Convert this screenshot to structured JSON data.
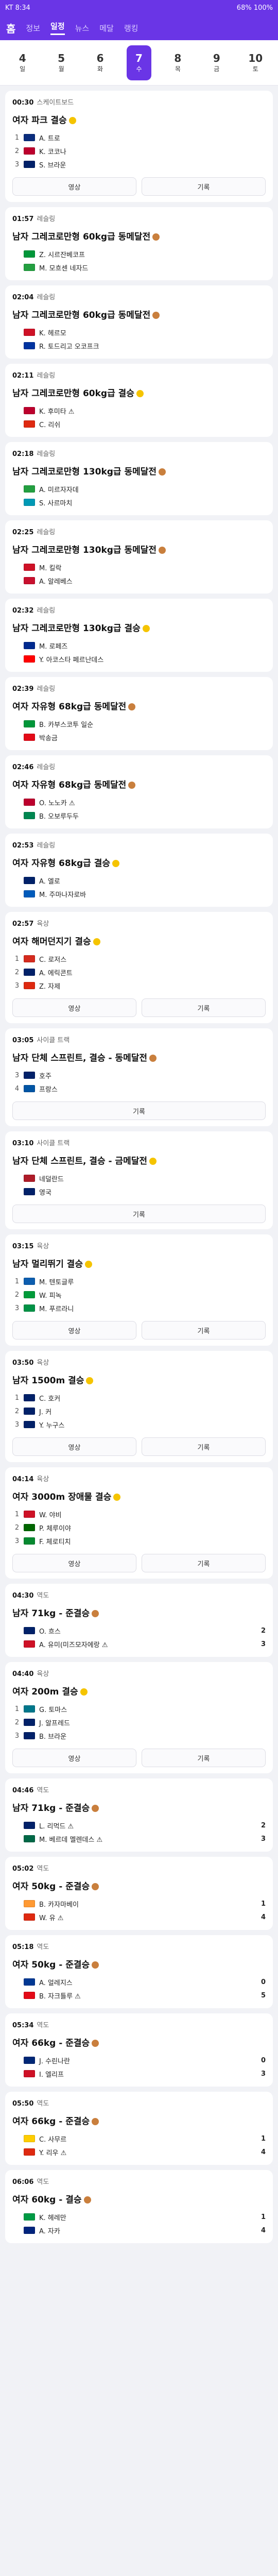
{
  "status": {
    "left": "KT 8:34",
    "right": "68% 100%"
  },
  "nav": {
    "logo": "홈",
    "tabs": [
      "정보",
      "일정",
      "뉴스",
      "메달",
      "랭킹"
    ],
    "active": 1
  },
  "dates": [
    {
      "day": "4",
      "dow": "일"
    },
    {
      "day": "5",
      "dow": "월"
    },
    {
      "day": "6",
      "dow": "화"
    },
    {
      "day": "7",
      "dow": "수"
    },
    {
      "day": "8",
      "dow": "목"
    },
    {
      "day": "9",
      "dow": "금"
    },
    {
      "day": "10",
      "dow": "토"
    }
  ],
  "active_date": 3,
  "events": [
    {
      "time": "00:30",
      "cat": "스케이트보드",
      "title": "여자 파크 결승",
      "medal": "gold",
      "rows": [
        {
          "rank": "1",
          "flag": "#0a2d7d",
          "name": "A. 트로"
        },
        {
          "rank": "2",
          "flag": "#bc002d",
          "name": "K. 코코나"
        },
        {
          "rank": "3",
          "flag": "#012169",
          "name": "S. 브라운"
        }
      ],
      "buttons": [
        "영상",
        "기록"
      ]
    },
    {
      "time": "01:57",
      "cat": "레슬링",
      "title": "남자 그레코로만형 60kg급 동메달전",
      "medal": "bronze",
      "rows": [
        {
          "rank": "",
          "flag": "#009639",
          "name": "Z. 시르잔베코프"
        },
        {
          "rank": "",
          "flag": "#239f40",
          "name": "M. 모흐센 네자드"
        }
      ]
    },
    {
      "time": "02:04",
      "cat": "레슬링",
      "title": "남자 그레코로만형 60kg급 동메달전",
      "medal": "bronze",
      "rows": [
        {
          "rank": "",
          "flag": "#ce1126",
          "name": "K. 헤르모"
        },
        {
          "rank": "",
          "flag": "#0033a0",
          "name": "R. 토드리고 오코프크"
        }
      ]
    },
    {
      "time": "02:11",
      "cat": "레슬링",
      "title": "남자 그레코로만형 60kg급 결승",
      "medal": "gold",
      "rows": [
        {
          "rank": "",
          "flag": "#bc002d",
          "name": "K. 후미타 ⚠"
        },
        {
          "rank": "",
          "flag": "#de2910",
          "name": "C. 리쉬"
        }
      ]
    },
    {
      "time": "02:18",
      "cat": "레슬링",
      "title": "남자 그레코로만형 130kg급 동메달전",
      "medal": "bronze",
      "rows": [
        {
          "rank": "",
          "flag": "#239f40",
          "name": "A. 미르자자데"
        },
        {
          "rank": "",
          "flag": "#0099b5",
          "name": "S. 사르마치"
        }
      ]
    },
    {
      "time": "02:25",
      "cat": "레슬링",
      "title": "남자 그레코로만형 130kg급 동메달전",
      "medal": "bronze",
      "rows": [
        {
          "rank": "",
          "flag": "#ce1126",
          "name": "M. 킬락"
        },
        {
          "rank": "",
          "flag": "#c8102e",
          "name": "A. 알레베스"
        }
      ]
    },
    {
      "time": "02:32",
      "cat": "레슬링",
      "title": "남자 그레코로만형 130kg급 결승",
      "medal": "gold",
      "rows": [
        {
          "rank": "",
          "flag": "#002a8f",
          "name": "M. 로페즈"
        },
        {
          "rank": "",
          "flag": "#ff0000",
          "name": "Y. 아코스타 페르난데스"
        }
      ]
    },
    {
      "time": "02:39",
      "cat": "레슬링",
      "title": "여자 자유형 68kg급 동메달전",
      "medal": "bronze",
      "rows": [
        {
          "rank": "",
          "flag": "#009639",
          "name": "B. 카부스코투 일순"
        },
        {
          "rank": "",
          "flag": "#e30a17",
          "name": "박송금"
        }
      ]
    },
    {
      "time": "02:46",
      "cat": "레슬링",
      "title": "여자 자유형 68kg급 동메달전",
      "medal": "bronze",
      "rows": [
        {
          "rank": "",
          "flag": "#bc002d",
          "name": "O. 노노카 ⚠"
        },
        {
          "rank": "",
          "flag": "#008751",
          "name": "B. 오보루두두"
        }
      ]
    },
    {
      "time": "02:53",
      "cat": "레슬링",
      "title": "여자 자유형 68kg급 결승",
      "medal": "gold",
      "rows": [
        {
          "rank": "",
          "flag": "#012169",
          "name": "A. 엘로"
        },
        {
          "rank": "",
          "flag": "#005bbb",
          "name": "M. 주마나자로바"
        }
      ]
    },
    {
      "time": "02:57",
      "cat": "육상",
      "title": "여자 해머던지기 결승",
      "medal": "gold",
      "rows": [
        {
          "rank": "1",
          "flag": "#d52b1e",
          "name": "C. 로저스"
        },
        {
          "rank": "2",
          "flag": "#012169",
          "name": "A. 에릭콘트"
        },
        {
          "rank": "3",
          "flag": "#de2910",
          "name": "Z. 자제"
        }
      ],
      "buttons": [
        "영상",
        "기록"
      ]
    },
    {
      "time": "03:05",
      "cat": "사이클 트랙",
      "title": "남자 단체 스프린트, 결승 - 동메달전",
      "medal": "bronze",
      "rows": [
        {
          "rank": "3",
          "flag": "#012169",
          "name": "호주"
        },
        {
          "rank": "4",
          "flag": "#0055a4",
          "name": "프랑스"
        }
      ],
      "buttons": [
        "기록"
      ]
    },
    {
      "time": "03:10",
      "cat": "사이클 트랙",
      "title": "남자 단체 스프린트, 결승 - 금메달전",
      "medal": "gold",
      "rows": [
        {
          "rank": "",
          "flag": "#ae1c28",
          "name": "네덜란드"
        },
        {
          "rank": "",
          "flag": "#012169",
          "name": "영국"
        }
      ],
      "buttons": [
        "기록"
      ]
    },
    {
      "time": "03:15",
      "cat": "육상",
      "title": "남자 멀리뛰기 결승",
      "medal": "gold",
      "rows": [
        {
          "rank": "1",
          "flag": "#0d5eaf",
          "name": "M. 텐토글루"
        },
        {
          "rank": "2",
          "flag": "#009b3a",
          "name": "W. 피녹"
        },
        {
          "rank": "3",
          "flag": "#009246",
          "name": "M. 푸르라니"
        }
      ],
      "buttons": [
        "영상",
        "기록"
      ]
    },
    {
      "time": "03:50",
      "cat": "육상",
      "title": "남자 1500m 결승",
      "medal": "gold",
      "rows": [
        {
          "rank": "1",
          "flag": "#012169",
          "name": "C. 호커"
        },
        {
          "rank": "2",
          "flag": "#012169",
          "name": "J. 커"
        },
        {
          "rank": "3",
          "flag": "#012169",
          "name": "Y. 누구스"
        }
      ],
      "buttons": [
        "영상",
        "기록"
      ]
    },
    {
      "time": "04:14",
      "cat": "육상",
      "title": "여자 3000m 장애물 결승",
      "medal": "gold",
      "rows": [
        {
          "rank": "1",
          "flag": "#ce1126",
          "name": "W. 야비"
        },
        {
          "rank": "2",
          "flag": "#006600",
          "name": "P. 체루이야"
        },
        {
          "rank": "3",
          "flag": "#078930",
          "name": "F. 체로티치"
        }
      ],
      "buttons": [
        "영상",
        "기록"
      ]
    },
    {
      "time": "04:30",
      "cat": "역도",
      "title": "남자 71kg - 준결승",
      "medal": "bronze",
      "rows": [
        {
          "rank": "",
          "flag": "#012169",
          "name": "O. 흐스",
          "score": "2"
        },
        {
          "rank": "",
          "flag": "#ce1126",
          "name": "A. 유미(미즈모자에랑 ⚠",
          "score": "3"
        }
      ]
    },
    {
      "time": "04:40",
      "cat": "육상",
      "title": "여자 200m 결승",
      "medal": "gold",
      "rows": [
        {
          "rank": "1",
          "flag": "#00778b",
          "name": "G. 토마스"
        },
        {
          "rank": "2",
          "flag": "#012169",
          "name": "J. 알프레드"
        },
        {
          "rank": "3",
          "flag": "#012169",
          "name": "B. 브라운"
        }
      ],
      "buttons": [
        "영상",
        "기록"
      ]
    },
    {
      "time": "04:46",
      "cat": "역도",
      "title": "남자 71kg - 준결승",
      "medal": "bronze",
      "rows": [
        {
          "rank": "",
          "flag": "#012169",
          "name": "L. 리먹드 ⚠",
          "score": "2"
        },
        {
          "rank": "",
          "flag": "#006847",
          "name": "M. 베르데 멜렌데스 ⚠",
          "score": "3"
        }
      ]
    },
    {
      "time": "05:02",
      "cat": "역도",
      "title": "여자 50kg - 준결승",
      "medal": "bronze",
      "rows": [
        {
          "rank": "",
          "flag": "#ff9933",
          "name": "B. 카자마베이",
          "score": "1"
        },
        {
          "rank": "",
          "flag": "#de2910",
          "name": "W. 유 ⚠",
          "score": "4"
        }
      ]
    },
    {
      "time": "05:18",
      "cat": "역도",
      "title": "여자 50kg - 준결승",
      "medal": "bronze",
      "rows": [
        {
          "rank": "",
          "flag": "#003893",
          "name": "A. 얼레지스",
          "score": "0"
        },
        {
          "rank": "",
          "flag": "#e30a17",
          "name": "B. 자크틀루 ⚠",
          "score": "5"
        }
      ]
    },
    {
      "time": "05:34",
      "cat": "역도",
      "title": "여자 66kg - 준결승",
      "medal": "bronze",
      "rows": [
        {
          "rank": "",
          "flag": "#002776",
          "name": "J. 수린나란",
          "score": "0"
        },
        {
          "rank": "",
          "flag": "#ce1126",
          "name": "I. 엘리프",
          "score": "3"
        }
      ]
    },
    {
      "time": "05:50",
      "cat": "역도",
      "title": "여자 66kg - 준결승",
      "medal": "bronze",
      "rows": [
        {
          "rank": "",
          "flag": "#ffcd00",
          "name": "C. 사무르",
          "score": "1"
        },
        {
          "rank": "",
          "flag": "#de2910",
          "name": "Y. 리우 ⚠",
          "score": "4"
        }
      ]
    },
    {
      "time": "06:06",
      "cat": "역도",
      "title": "여자 60kg - 결승",
      "medal": "bronze",
      "rows": [
        {
          "rank": "",
          "flag": "#009a44",
          "name": "K. 헤레만",
          "score": "1"
        },
        {
          "rank": "",
          "flag": "#00247d",
          "name": "A. 자카",
          "score": "4"
        }
      ]
    }
  ]
}
